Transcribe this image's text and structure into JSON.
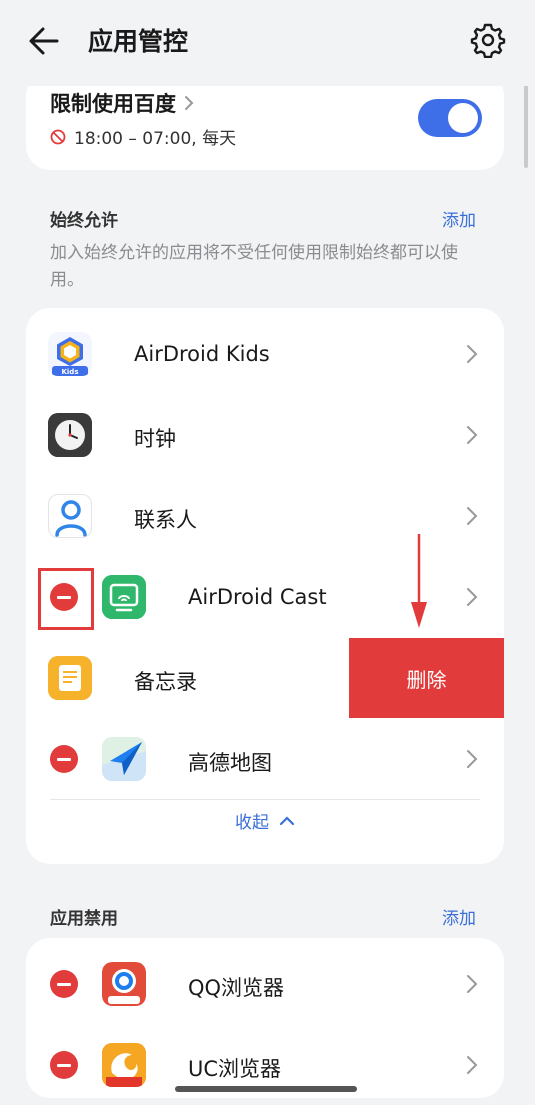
{
  "header": {
    "title": "应用管控",
    "back_icon": "arrow-left-icon",
    "settings_icon": "gear-icon"
  },
  "limit": {
    "title": "限制使用百度",
    "schedule": "18:00 – 07:00, 每天",
    "toggle_on": true,
    "accent": "#3f6fe8"
  },
  "always_allow": {
    "title": "始终允许",
    "action": "添加",
    "description": "加入始终允许的应用将不受任何使用限制始终都可以使用。",
    "apps": [
      {
        "name": "AirDroid Kids",
        "icon": "airdroid-kids-icon",
        "icon_label": "Kids",
        "deletable": false
      },
      {
        "name": "时钟",
        "icon": "clock-icon",
        "deletable": false
      },
      {
        "name": "联系人",
        "icon": "contacts-icon",
        "deletable": false
      },
      {
        "name": "AirDroid Cast",
        "icon": "airdroid-cast-icon",
        "deletable": true
      },
      {
        "name": "备忘录",
        "icon": "notes-icon",
        "deletable": false
      },
      {
        "name": "高德地图",
        "icon": "amap-icon",
        "deletable": true
      }
    ],
    "collapse_label": "收起"
  },
  "delete_action": {
    "label": "删除",
    "color": "#e23b3b"
  },
  "app_ban": {
    "title": "应用禁用",
    "action": "添加",
    "apps": [
      {
        "name": "QQ浏览器",
        "icon": "qq-browser-icon",
        "deletable": true
      },
      {
        "name": "UC浏览器",
        "icon": "uc-browser-icon",
        "deletable": true
      }
    ]
  }
}
